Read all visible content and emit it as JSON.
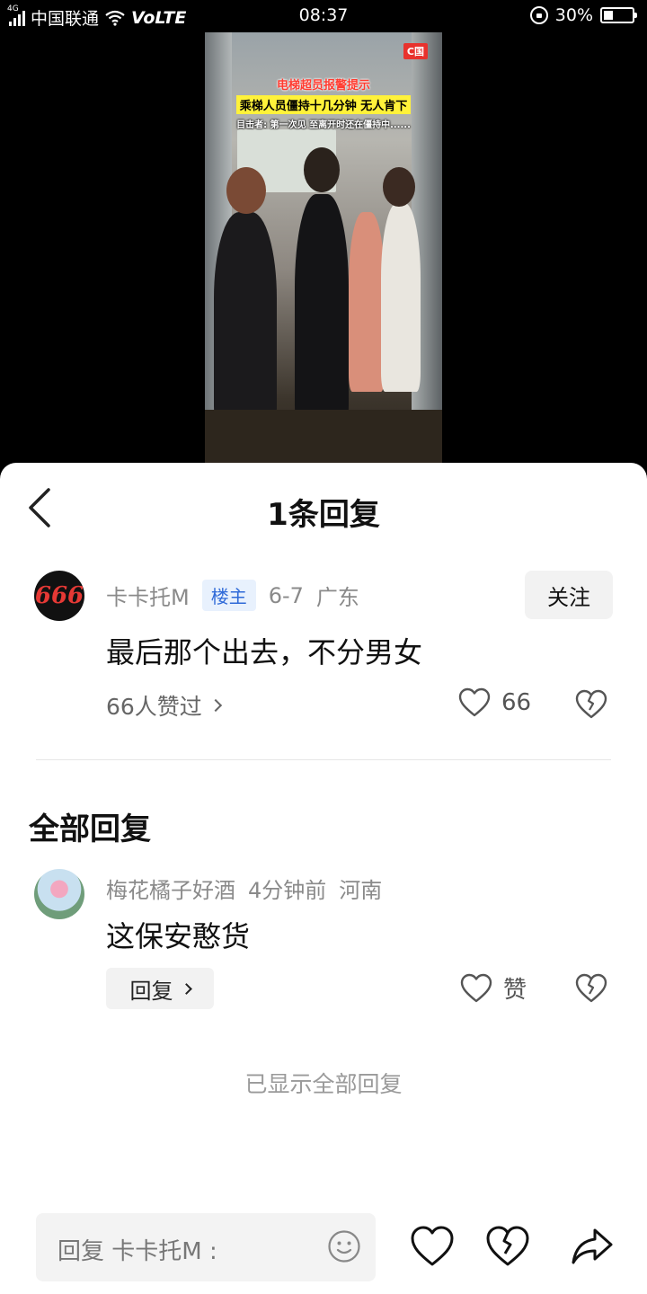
{
  "status_bar": {
    "network_type": "4G",
    "carrier": "中国联通",
    "volte": "VoLTE",
    "time": "08:37",
    "battery_text": "30%",
    "battery_level": 0.3
  },
  "video": {
    "logo": "C国",
    "caption_line1": "电梯超员报警提示",
    "caption_line2": "乘梯人员僵持十几分钟 无人肯下",
    "caption_line3": "目击者: 第一次见 至离开时还在僵持中......"
  },
  "sheet": {
    "title": "1条回复",
    "main_comment": {
      "avatar_text": "666",
      "username": "卡卡托M",
      "badge": "楼主",
      "date": "6-7",
      "location": "广东",
      "follow_label": "关注",
      "text": "最后那个出去，不分男女",
      "likers_text": "66人赞过",
      "like_count": "66"
    },
    "section_title": "全部回复",
    "reply": {
      "username": "梅花橘子好酒",
      "time": "4分钟前",
      "location": "河南",
      "text": "这保安憨货",
      "reply_button_label": "回复",
      "like_label": "赞"
    },
    "all_shown_text": "已显示全部回复",
    "input_placeholder": "回复 卡卡托M :"
  },
  "icons": {
    "back": "chevron-left-icon",
    "like": "heart-icon",
    "dislike": "broken-heart-icon",
    "emoji": "smiley-icon",
    "share": "share-arrow-icon"
  },
  "colors": {
    "badge_blue": "#2f6ad8",
    "badge_bg": "#e8f1fd",
    "caption_red": "#ff3b30",
    "caption_yellow": "#fff23a"
  }
}
